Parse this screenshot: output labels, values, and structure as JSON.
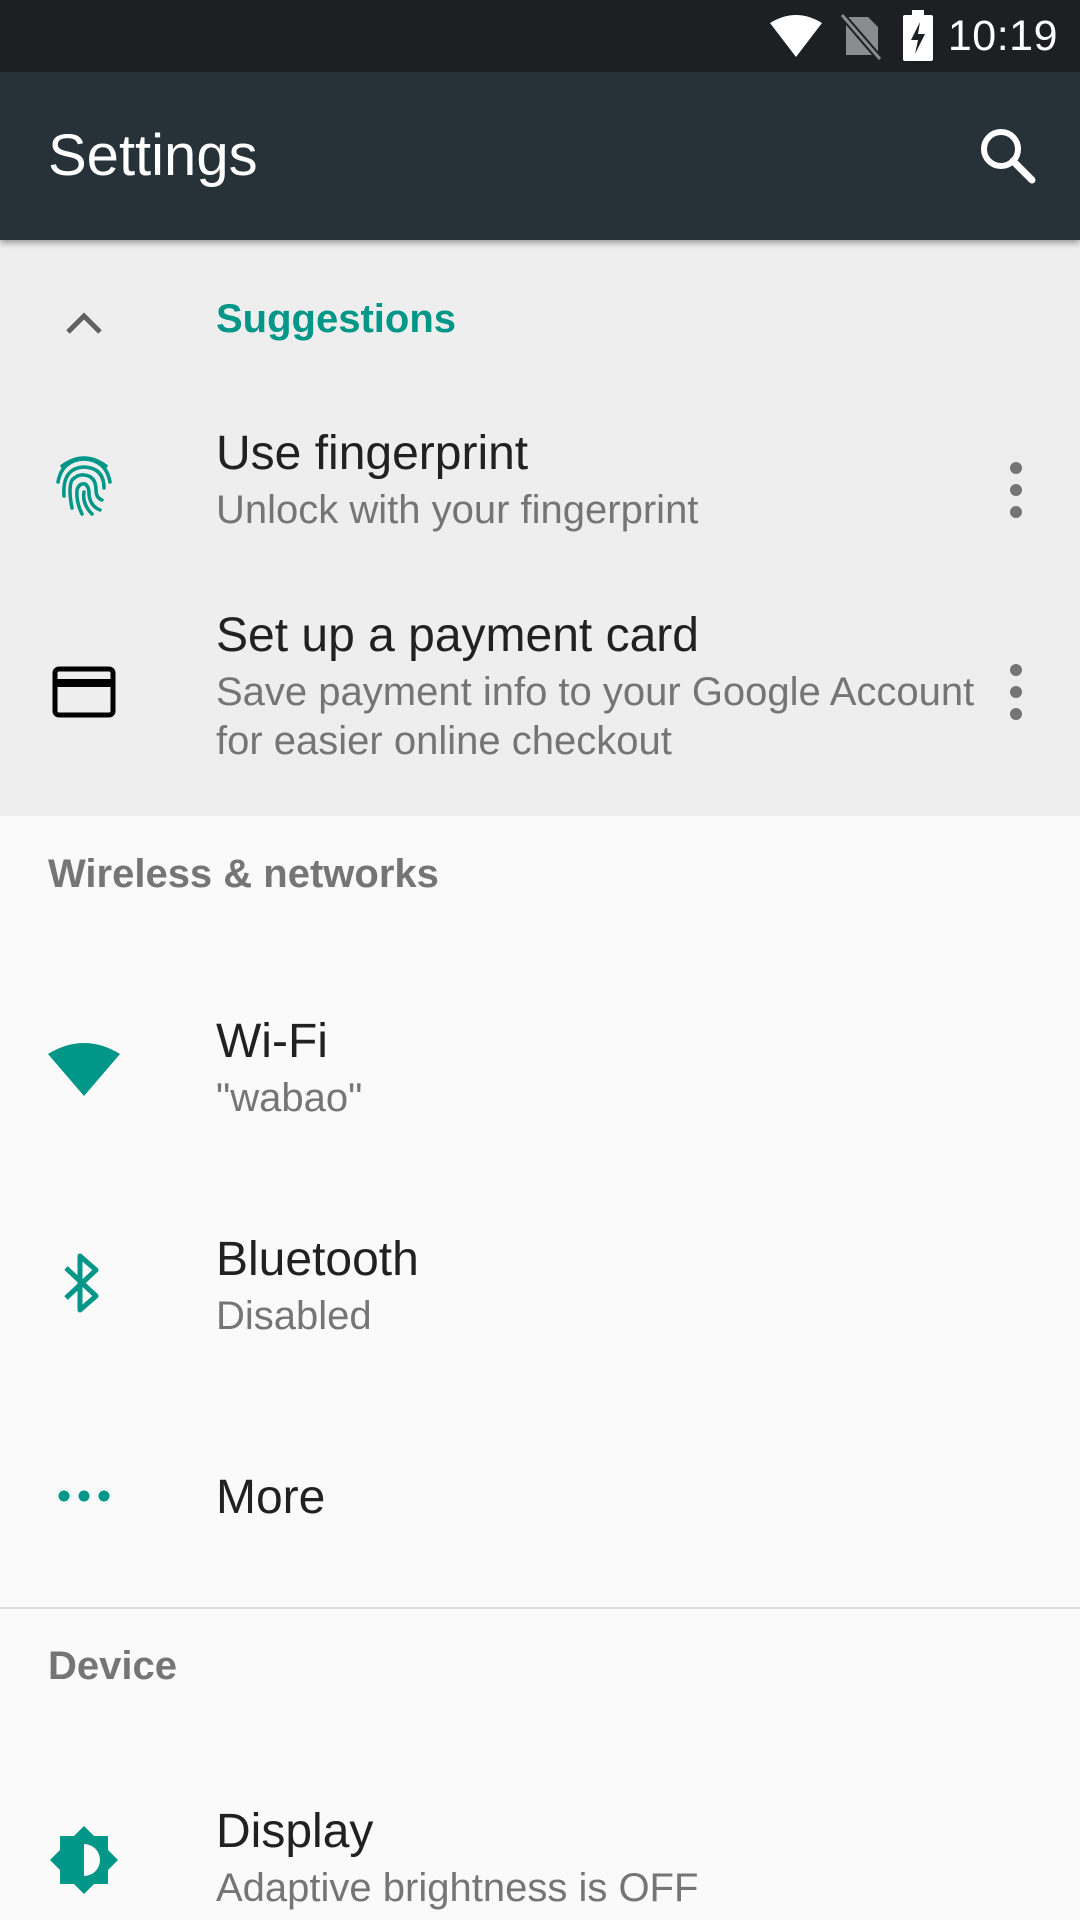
{
  "status_bar": {
    "time": "10:19",
    "icons": [
      "wifi-icon",
      "no-sim-icon",
      "battery-charging-icon"
    ]
  },
  "app_bar": {
    "title": "Settings",
    "search_icon": "search-icon"
  },
  "suggestions": {
    "header": "Suggestions",
    "items": [
      {
        "title": "Use fingerprint",
        "subtitle": "Unlock with your fingerprint",
        "icon": "fingerprint-icon"
      },
      {
        "title": "Set up a payment card",
        "subtitle": "Save payment info to your Google Account for easier online checkout",
        "icon": "credit-card-icon"
      }
    ]
  },
  "sections": {
    "wireless": {
      "header": "Wireless & networks",
      "items": [
        {
          "title": "Wi-Fi",
          "subtitle": "\"wabao\"",
          "icon": "wifi-icon"
        },
        {
          "title": "Bluetooth",
          "subtitle": "Disabled",
          "icon": "bluetooth-icon"
        },
        {
          "title": "More",
          "icon": "more-horiz-icon"
        }
      ]
    },
    "device": {
      "header": "Device",
      "items": [
        {
          "title": "Display",
          "subtitle": "Adaptive brightness is OFF",
          "icon": "brightness-icon"
        }
      ]
    }
  },
  "colors": {
    "accent": "#009688",
    "app_bar": "#263238",
    "status_bar": "#1c2023",
    "suggestions_bg": "#eeeeee",
    "page_bg": "#fafafa"
  }
}
